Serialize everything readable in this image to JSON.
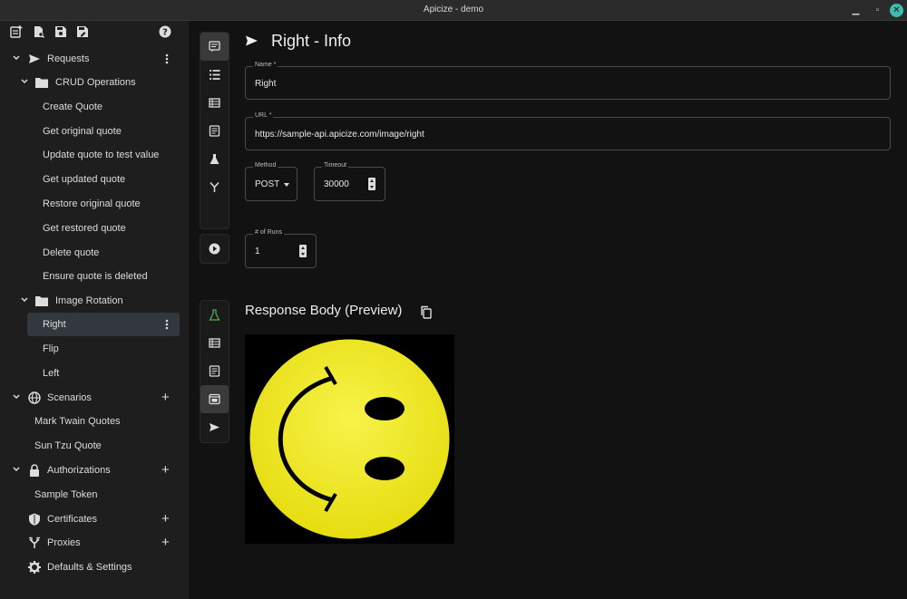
{
  "window": {
    "title": "Apicize - demo"
  },
  "sidebar": {
    "requests_label": "Requests",
    "groups": [
      {
        "label": "CRUD Operations",
        "items": [
          "Create Quote",
          "Get original quote",
          "Update quote to test value",
          "Get updated quote",
          "Restore original quote",
          "Get restored quote",
          "Delete quote",
          "Ensure quote is deleted"
        ]
      },
      {
        "label": "Image Rotation",
        "items": [
          "Right",
          "Flip",
          "Left"
        ]
      }
    ],
    "scenarios_label": "Scenarios",
    "scenarios": [
      "Mark Twain Quotes",
      "Sun Tzu Quote"
    ],
    "authorizations_label": "Authorizations",
    "authorizations": [
      "Sample Token"
    ],
    "certificates_label": "Certificates",
    "proxies_label": "Proxies",
    "settings_label": "Defaults & Settings"
  },
  "main": {
    "title": "Right - Info",
    "name_label": "Name *",
    "name_value": "Right",
    "url_label": "URL *",
    "url_value": "https://sample-api.apicize.com/image/right",
    "method_label": "Method",
    "method_value": "POST",
    "timeout_label": "Timeout",
    "timeout_value": "30000",
    "runs_label": "# of Runs",
    "runs_value": "1",
    "response_title": "Response Body (Preview)"
  },
  "colors": {
    "accent": "#3fbcb0",
    "selected": "#33383f",
    "test_icon": "#4caf50",
    "smiley": "#f2ee1b"
  }
}
